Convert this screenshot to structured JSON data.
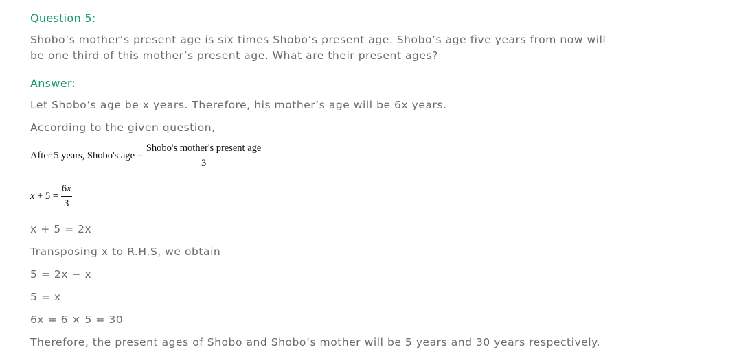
{
  "question": {
    "heading": "Question 5:",
    "line1": "Shobo’s mother’s present age is six times Shobo’s present age. Shobo’s age five years from now will",
    "line2": "be one third of this mother’s present age. What are their present ages?"
  },
  "answer": {
    "heading": "Answer:",
    "let": "Let Shobo’s age be x years. Therefore, his mother’s age will be 6x years.",
    "according": "According to the given question,",
    "eq1": {
      "lhs": "After 5 years, Shobo's age =",
      "numerator": "Shobo's mother's present age",
      "denominator": "3"
    },
    "eq2": {
      "lhs_var": "x",
      "lhs_rest": " + 5 =",
      "numerator_coef": "6",
      "numerator_var": "x",
      "denominator": "3"
    },
    "step1": "x + 5 = 2x",
    "transposing": "Transposing x to R.H.S, we obtain",
    "step2": "5 = 2x − x",
    "step3": "5 = x",
    "step4": "6x = 6 × 5 = 30",
    "conclusion": "Therefore, the present ages of Shobo and Shobo’s mother will be 5 years and 30 years respectively."
  }
}
